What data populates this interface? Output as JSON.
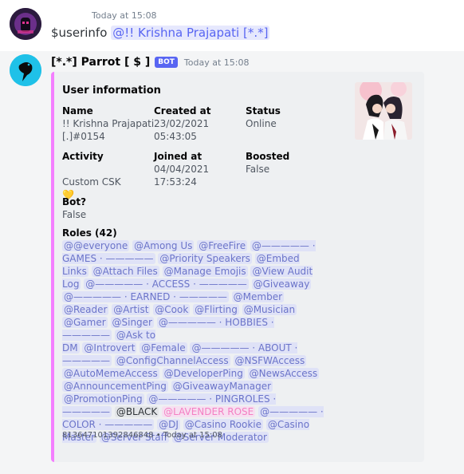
{
  "message1": {
    "timestamp": "Today at 15:08",
    "command": "$userinfo",
    "mention": "@!! Krishna Prajapati [*.*]"
  },
  "message2": {
    "username": "[*.*] Parrot [ $ ]",
    "bot_badge": "BOT",
    "timestamp": "Today at 15:08",
    "embed": {
      "title": "User information",
      "accent_color": "#f47fff",
      "fields": {
        "name": {
          "label": "Name",
          "value": "!! Krishna Prajapati\n[.]#0154"
        },
        "created": {
          "label": "Created at",
          "value": "23/02/2021\n05:43:05"
        },
        "status": {
          "label": "Status",
          "value": "Online"
        },
        "activity": {
          "label": "Activity",
          "value": "Custom CSK",
          "emoji": "💛"
        },
        "joined": {
          "label": "Joined at",
          "value": "04/04/2021\n17:53:24"
        },
        "boosted": {
          "label": "Boosted",
          "value": "False"
        },
        "bot": {
          "label": "Bot?",
          "value": "False"
        }
      },
      "roles_label": "Roles (42)",
      "roles": [
        "@@everyone",
        "@Among Us",
        "@FreeFire",
        "@————— ·\nGAMES · —————",
        "@Priority Speakers",
        "@Embed Links",
        "@Attach Files",
        "@Manage Emojis",
        "@View Audit Log",
        "@————— · ACCESS · —————",
        "@Giveaway",
        "@————— · EARNED · —————",
        "@Member",
        "@Reader",
        "@Artist",
        "@Cook",
        "@Flirting",
        "@Musician",
        "@Gamer",
        "@Singer",
        "@————— · HOBBIES · —————",
        "@Ask to\nDM",
        "@Introvert",
        "@Female",
        "@————— · ABOUT ·\n—————",
        "@ConfigChannelAccess",
        "@NSFWAccess",
        "@AutoMemeAccess",
        "@DeveloperPing",
        "@NewsAccess",
        "@AnnouncementPing",
        "@GiveawayManager",
        "@PromotionPing",
        "@————— · PINGROLES · —————",
        "@BLACK",
        "@LAVENDER ROSE",
        "@————— · COLOR · —————",
        "@DJ",
        "@Casino Rookie",
        "@Casino Master",
        "@Server Staff",
        "@Server Moderator"
      ],
      "footer": "813647101392846848 • Today at 15:08"
    }
  }
}
